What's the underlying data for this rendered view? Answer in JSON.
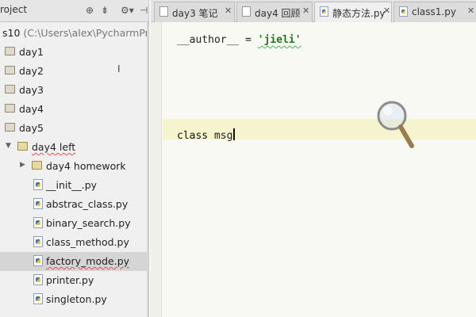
{
  "project": {
    "title": "roject",
    "tree": [
      {
        "label": "s10",
        "dim": " (C:\\Users\\alex\\PycharmProjects",
        "kind": "root"
      },
      {
        "label": "day1",
        "kind": "folder"
      },
      {
        "label": "day2",
        "kind": "folder"
      },
      {
        "label": "day3",
        "kind": "folder"
      },
      {
        "label": "day4",
        "kind": "folder"
      },
      {
        "label": "day5",
        "kind": "folder"
      },
      {
        "label": "day4 left",
        "kind": "folder-open"
      },
      {
        "label": "day4 homework",
        "kind": "folder-closed"
      },
      {
        "label": "__init__.py",
        "kind": "py"
      },
      {
        "label": "abstrac_class.py",
        "kind": "py"
      },
      {
        "label": "binary_search.py",
        "kind": "py"
      },
      {
        "label": "class_method.py",
        "kind": "py"
      },
      {
        "label": "factory_mode.py",
        "kind": "py",
        "selected": true
      },
      {
        "label": "printer.py",
        "kind": "py"
      },
      {
        "label": "singleton.py",
        "kind": "py"
      }
    ]
  },
  "tabs": [
    {
      "label": "day3 笔记",
      "icon": "document-icon"
    },
    {
      "label": "day4 回顾",
      "icon": "document-icon"
    },
    {
      "label": "静态方法.py",
      "icon": "python-file-icon"
    },
    {
      "label": "class1.py",
      "icon": "python-file-icon"
    }
  ],
  "editor": {
    "line1_var": "__author__",
    "line1_eq": " = ",
    "line1_str": "'jieli'",
    "line2_kw": "class",
    "line2_name": "msg"
  },
  "colors": {
    "string": "#1c7a1c",
    "current_line": "#f6f4cf",
    "selected_row": "#d5d5d5"
  }
}
